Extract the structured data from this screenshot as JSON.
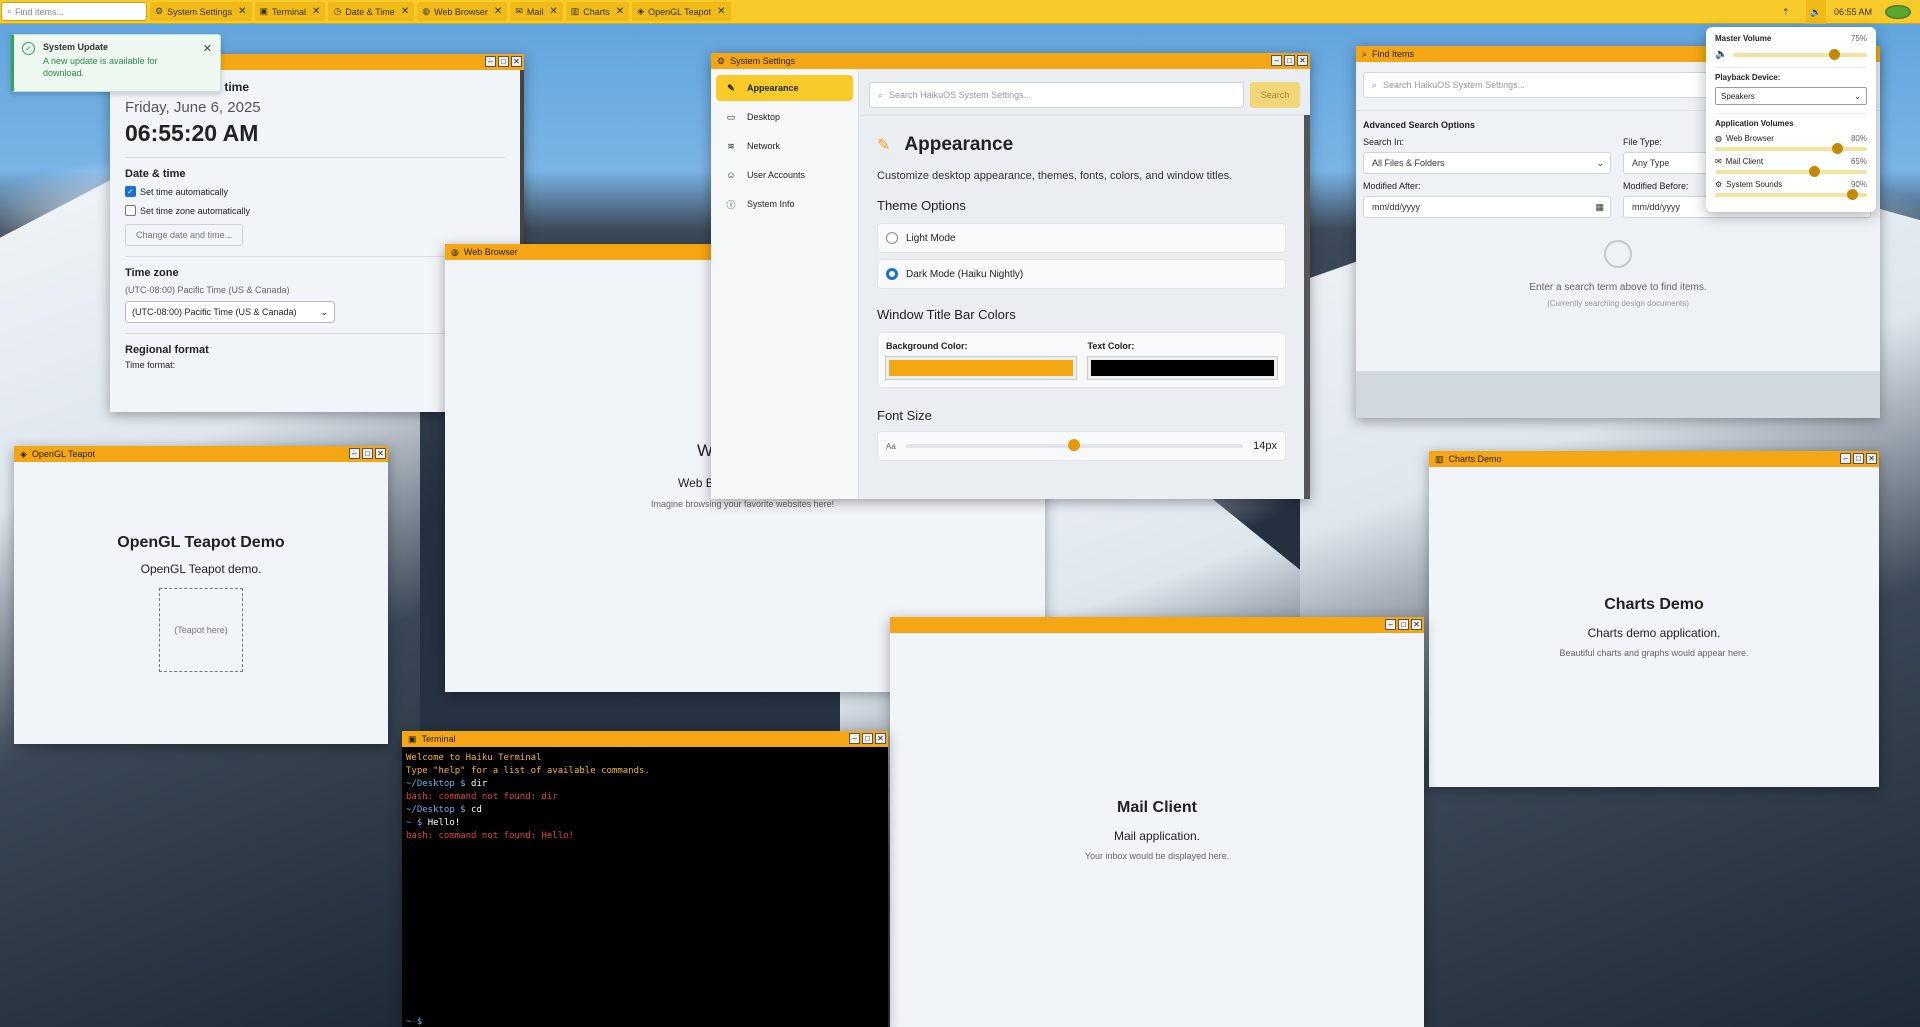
{
  "taskbar": {
    "find_placeholder": "Find items...",
    "tabs": [
      {
        "label": "System Settings",
        "icon": "gear-icon"
      },
      {
        "label": "Terminal",
        "icon": "terminal-icon"
      },
      {
        "label": "Date & Time",
        "icon": "clock-icon"
      },
      {
        "label": "Web Browser",
        "icon": "globe-icon"
      },
      {
        "label": "Mail",
        "icon": "mail-icon"
      },
      {
        "label": "Charts",
        "icon": "chart-icon"
      },
      {
        "label": "OpenGL Teapot",
        "icon": "teapot-icon"
      }
    ],
    "close_glyph": "✕",
    "time": "06:55 AM"
  },
  "notification": {
    "title": "System Update",
    "body": "A new update is available for download."
  },
  "datetime": {
    "heading": "Current date and time",
    "date": "Friday, June 6, 2025",
    "time": "06:55:20 AM",
    "section_title": "Date & time",
    "opt_auto_time": "Set time automatically",
    "opt_auto_zone": "Set time zone automatically",
    "change_button": "Change date and time...",
    "tz_title": "Time zone",
    "tz_current": "(UTC-08:00) Pacific Time (US & Canada)",
    "tz_select": "(UTC-08:00) Pacific Time (US & Canada)",
    "regional_title": "Regional format",
    "time_format_label": "Time format:"
  },
  "browser": {
    "title": "Web Browser",
    "heading": "W",
    "subtitle": "Web B",
    "note": "Imagine browsing your favorite websites here!"
  },
  "settings": {
    "title": "System Settings",
    "sidebar": [
      {
        "label": "Appearance",
        "icon": "brush-icon"
      },
      {
        "label": "Desktop",
        "icon": "monitor-icon"
      },
      {
        "label": "Network",
        "icon": "wifi-icon"
      },
      {
        "label": "User Accounts",
        "icon": "user-icon"
      },
      {
        "label": "System Info",
        "icon": "info-icon"
      }
    ],
    "search_placeholder": "Search HaikuOS System Settings...",
    "search_button": "Search",
    "page_title": "Appearance",
    "page_desc": "Customize desktop appearance, themes, fonts, colors, and window titles.",
    "theme_title": "Theme Options",
    "theme_light": "Light Mode",
    "theme_dark": "Dark Mode (Haiku Nightly)",
    "colors_title": "Window Title Bar Colors",
    "bg_color_label": "Background Color:",
    "text_color_label": "Text Color:",
    "bg_color": "#f5a614",
    "text_color": "#000000",
    "font_title": "Font Size",
    "font_small": "Aa",
    "font_value": "14px",
    "font_fraction": 0.5
  },
  "find": {
    "title": "Find Items",
    "search_placeholder": "Search HaikuOS System Settings...",
    "advanced_title": "Advanced Search Options",
    "search_in_label": "Search In:",
    "search_in_value": "All Files & Folders",
    "file_type_label": "File Type:",
    "file_type_value": "Any Type",
    "modified_after_label": "Modified After:",
    "modified_before_label": "Modified Before:",
    "date_placeholder": "mm/dd/yyyy",
    "empty_text": "Enter a search term above to find items.",
    "empty_sub": "(Currently searching design documents)"
  },
  "volume": {
    "master_label": "Master Volume",
    "master_value": "75%",
    "master_fraction": 0.75,
    "device_label": "Playback Device:",
    "device_value": "Speakers",
    "apps_title": "Application Volumes",
    "apps": [
      {
        "label": "Web Browser",
        "value": "80%",
        "fraction": 0.8,
        "icon": "globe-icon"
      },
      {
        "label": "Mail Client",
        "value": "65%",
        "fraction": 0.65,
        "icon": "mail-icon"
      },
      {
        "label": "System Sounds",
        "value": "90%",
        "fraction": 0.9,
        "icon": "gear-icon"
      }
    ]
  },
  "teapot": {
    "title": "OpenGL Teapot",
    "heading": "OpenGL Teapot Demo",
    "subtitle": "OpenGL Teapot demo.",
    "placeholder": "(Teapot here)"
  },
  "charts": {
    "title": "Charts Demo",
    "heading": "Charts Demo",
    "subtitle": "Charts demo application.",
    "note": "Beautiful charts and graphs would appear here."
  },
  "mail": {
    "heading": "Mail Client",
    "subtitle": "Mail application.",
    "note": "Your inbox would be displayed here."
  },
  "terminal": {
    "title": "Terminal",
    "lines": [
      {
        "text": "Welcome to Haiku Terminal",
        "color": "#f5b82a"
      },
      {
        "text": "Type \"help\" for a list of available commands.",
        "color": "#f5b82a"
      },
      {
        "prompt": "~/Desktop $ ",
        "text": "dir",
        "color": "#ffffff"
      },
      {
        "text": "bash: command not found: dir",
        "color": "#e0443c"
      },
      {
        "prompt": "~/Desktop $ ",
        "text": "cd",
        "color": "#ffffff"
      },
      {
        "prompt": "~ $ ",
        "text": "Hello!",
        "color": "#ffffff"
      },
      {
        "text": "bash: command not found: Hello!",
        "color": "#e0443c"
      }
    ],
    "final_prompt": "~ $"
  }
}
